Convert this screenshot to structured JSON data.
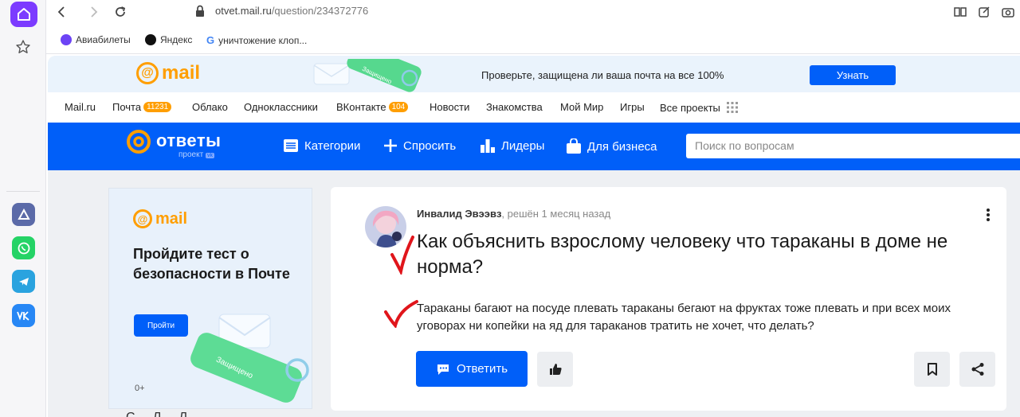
{
  "browser": {
    "url_host": "otvet.mail.ru",
    "url_path": "/question/234372776",
    "bookmarks": [
      {
        "label": "Авиабилеты",
        "color": "#6c43f5"
      },
      {
        "label": "Яндекс",
        "color": "#111111"
      },
      {
        "label": "уничтожение клоп...",
        "color": "#4285f4"
      }
    ]
  },
  "banner": {
    "logo": "mail",
    "deco_tag": "Защищено",
    "text": "Проверьте, защищена ли ваша почта на все 100%",
    "button": "Узнать"
  },
  "portal": {
    "items": [
      {
        "label": "Mail.ru"
      },
      {
        "label": "Почта",
        "badge": "11231"
      },
      {
        "label": "Облако"
      },
      {
        "label": "Одноклассники"
      },
      {
        "label": "ВКонтакте",
        "badge": "104"
      },
      {
        "label": "Новости"
      },
      {
        "label": "Знакомства"
      },
      {
        "label": "Мой Мир"
      },
      {
        "label": "Игры"
      },
      {
        "label": "Все проекты"
      }
    ]
  },
  "header": {
    "brand": "ответы",
    "brand_sub": "проект",
    "brand_sub_badge": "vk",
    "nav": [
      "Категории",
      "Спросить",
      "Лидеры",
      "Для бизнеса"
    ],
    "search_placeholder": "Поиск по вопросам"
  },
  "ad": {
    "logo": "mail",
    "text": "Пройдите тест о безопасности в Почте",
    "button": "Пройти",
    "deco_tag": "Защищено",
    "age": "0+"
  },
  "question": {
    "author": "Инвалид Эвээвз",
    "meta": ", решён 1 месяц назад",
    "title": "Как объяснить взрослому человеку что тараканы в доме не норма?",
    "body": "Тараканы багают на посуде плевать тараканы бегают на фруктах тоже плевать и при всех моих уговорах ни копейки на яд для тараканов тратить не хочет, что делать?",
    "reply_button": "Ответить"
  },
  "below": {
    "cut_text": "С ... Л ... Л"
  },
  "colors": {
    "primary": "#005ff9",
    "mail_orange": "#ff9e00",
    "mark_red": "#e0151b"
  }
}
